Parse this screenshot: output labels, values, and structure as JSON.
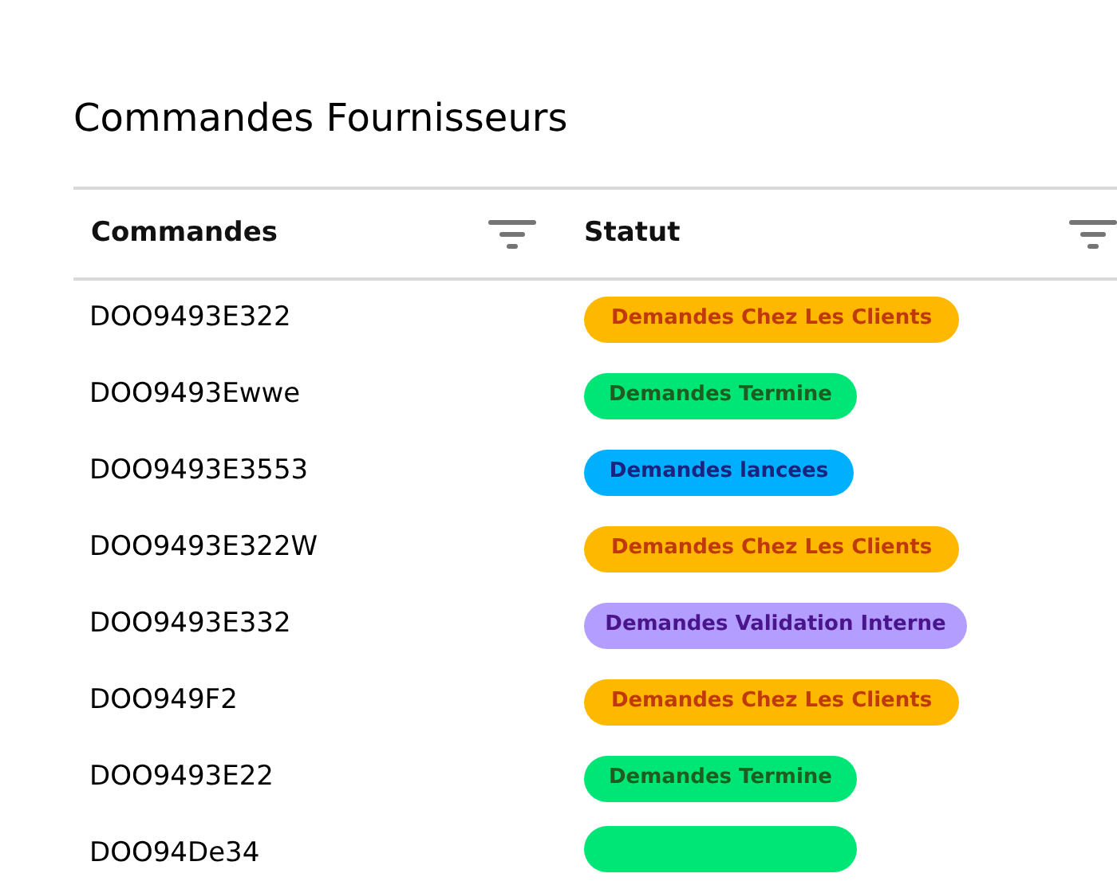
{
  "title": "Commandes Fournisseurs",
  "table": {
    "columns": [
      "Commandes",
      "Statut"
    ],
    "rows": [
      {
        "order": "DOO9493E322",
        "status": {
          "kind": "clients",
          "label": "Demandes Chez Les Clients"
        }
      },
      {
        "order": "DOO9493Ewwe",
        "status": {
          "kind": "termine",
          "label": "Demandes Termine"
        }
      },
      {
        "order": "DOO9493E3553",
        "status": {
          "kind": "lancees",
          "label": "Demandes lancees"
        }
      },
      {
        "order": "DOO9493E322W",
        "status": {
          "kind": "clients",
          "label": "Demandes Chez Les Clients"
        }
      },
      {
        "order": "DOO9493E332",
        "status": {
          "kind": "validation",
          "label": "Demandes Validation Interne"
        }
      },
      {
        "order": "DOO949F2",
        "status": {
          "kind": "clients",
          "label": "Demandes Chez Les Clients"
        }
      },
      {
        "order": "DOO9493E22",
        "status": {
          "kind": "termine",
          "label": "Demandes Termine"
        }
      },
      {
        "order": "DOO94De34",
        "status": {
          "kind": "termine"
        }
      }
    ]
  }
}
